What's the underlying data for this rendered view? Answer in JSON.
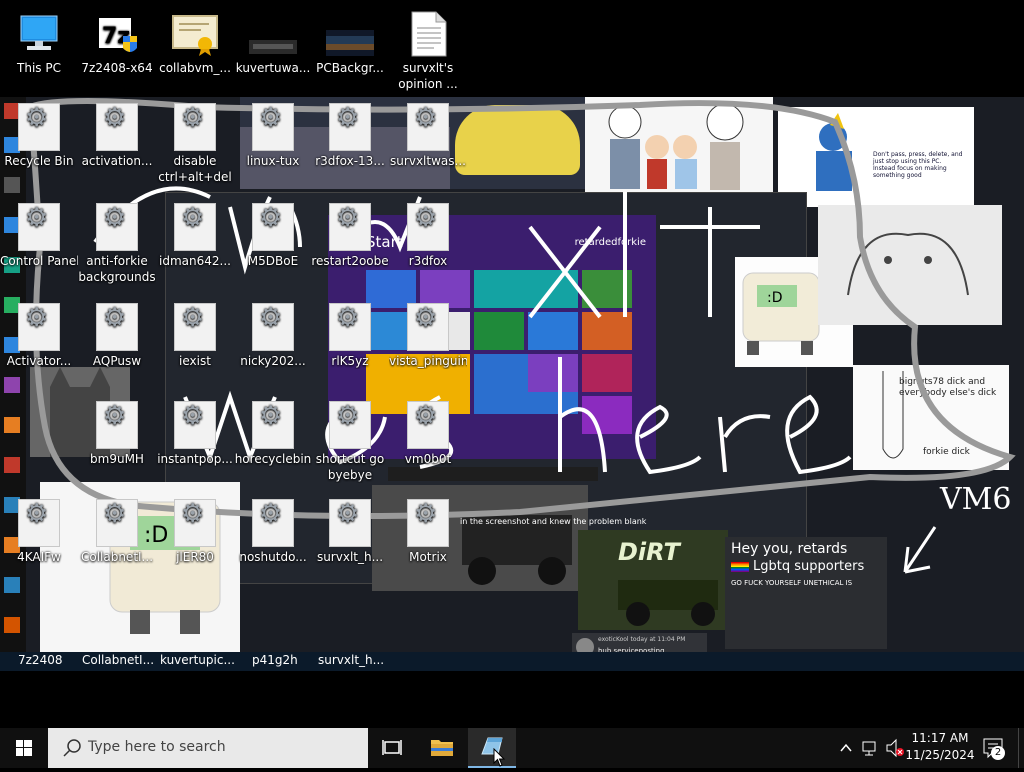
{
  "desktop_icons": [
    {
      "label": "This PC",
      "icon": "computer-icon"
    },
    {
      "label": "7z2408-x64",
      "icon": "7zip-installer-icon"
    },
    {
      "label": "collabvm_...",
      "icon": "certificate-icon"
    },
    {
      "label": "kuvertuwa...",
      "icon": "image-thumbnail-icon"
    },
    {
      "label": "PCBackgr...",
      "icon": "image-thumbnail-icon"
    },
    {
      "label": "survxlt's opinion ...",
      "icon": "text-document-icon"
    }
  ],
  "wallpaper_icons": [
    {
      "label": "Recycle Bin"
    },
    {
      "label": "activation..."
    },
    {
      "label": "disable ctrl+alt+del"
    },
    {
      "label": "linux-tux"
    },
    {
      "label": "r3dfox-13..."
    },
    {
      "label": "survxltwas..."
    },
    {
      "label": "Control Panel"
    },
    {
      "label": "anti-forkie backgrounds"
    },
    {
      "label": "idman642..."
    },
    {
      "label": "M5DBoE"
    },
    {
      "label": "restart2oobe"
    },
    {
      "label": "r3dfox"
    },
    {
      "label": "Activator..."
    },
    {
      "label": "AQPusw"
    },
    {
      "label": "iexist"
    },
    {
      "label": "nicky202..."
    },
    {
      "label": "rlK5yz"
    },
    {
      "label": "vista_pinguin"
    },
    {
      "label": "bm9uMH"
    },
    {
      "label": "instantpop..."
    },
    {
      "label": "horecyclebin"
    },
    {
      "label": "shortcut go byebye"
    },
    {
      "label": "vm0b0t"
    },
    {
      "label": "4KAIFw"
    },
    {
      "label": "CollabnetI..."
    },
    {
      "label": "jlER80"
    },
    {
      "label": "noshutdo..."
    },
    {
      "label": "survxlt_h..."
    },
    {
      "label": "Motrix"
    }
  ],
  "wallpaper_text": {
    "scrawl_line1": "survxlt",
    "scrawl_line2": "was here",
    "vm_label": "VM6",
    "win8_start": "Start",
    "win8_user": "retardedforkie",
    "hey_you": "Hey you, retards",
    "lgbtq": "Lgbtq supporters",
    "go_line": "GO FUCK YOURSELF UNETHICAL IS",
    "dirt": "DiRT",
    "note_text": "bignuts78 dick and everybody else's dick",
    "forkie_dick": "forkie dick",
    "chat_line": "exoticKool  today at 11:04 PM",
    "chat_msg": "hub serviceposting",
    "sticky_note": "Don't pass, press, delete, and just stop using this PC. Instead focus on making something good",
    "comic_caption": "in the screenshot and knew the problem blank"
  },
  "inner_taskbar": [
    {
      "label": "7z2408"
    },
    {
      "label": "CollabnetI..."
    },
    {
      "label": "kuvertupic..."
    },
    {
      "label": "p41g2h"
    },
    {
      "label": "survxlt_h..."
    }
  ],
  "taskbar": {
    "search_placeholder": "Type here to search",
    "apps": [
      {
        "name": "task-view",
        "icon": "task-view-icon"
      },
      {
        "name": "file-explorer",
        "icon": "folder-icon"
      },
      {
        "name": "open-app",
        "icon": "app-window-icon",
        "active": true
      }
    ],
    "time": "11:17 AM",
    "date": "11/25/2024",
    "notifications_count": "2"
  },
  "colors": {
    "taskbar_bg": "#101010",
    "search_bg": "#e9e9e9",
    "accent": "#7fb7e6",
    "win8_purple": "#3b1e6e"
  }
}
